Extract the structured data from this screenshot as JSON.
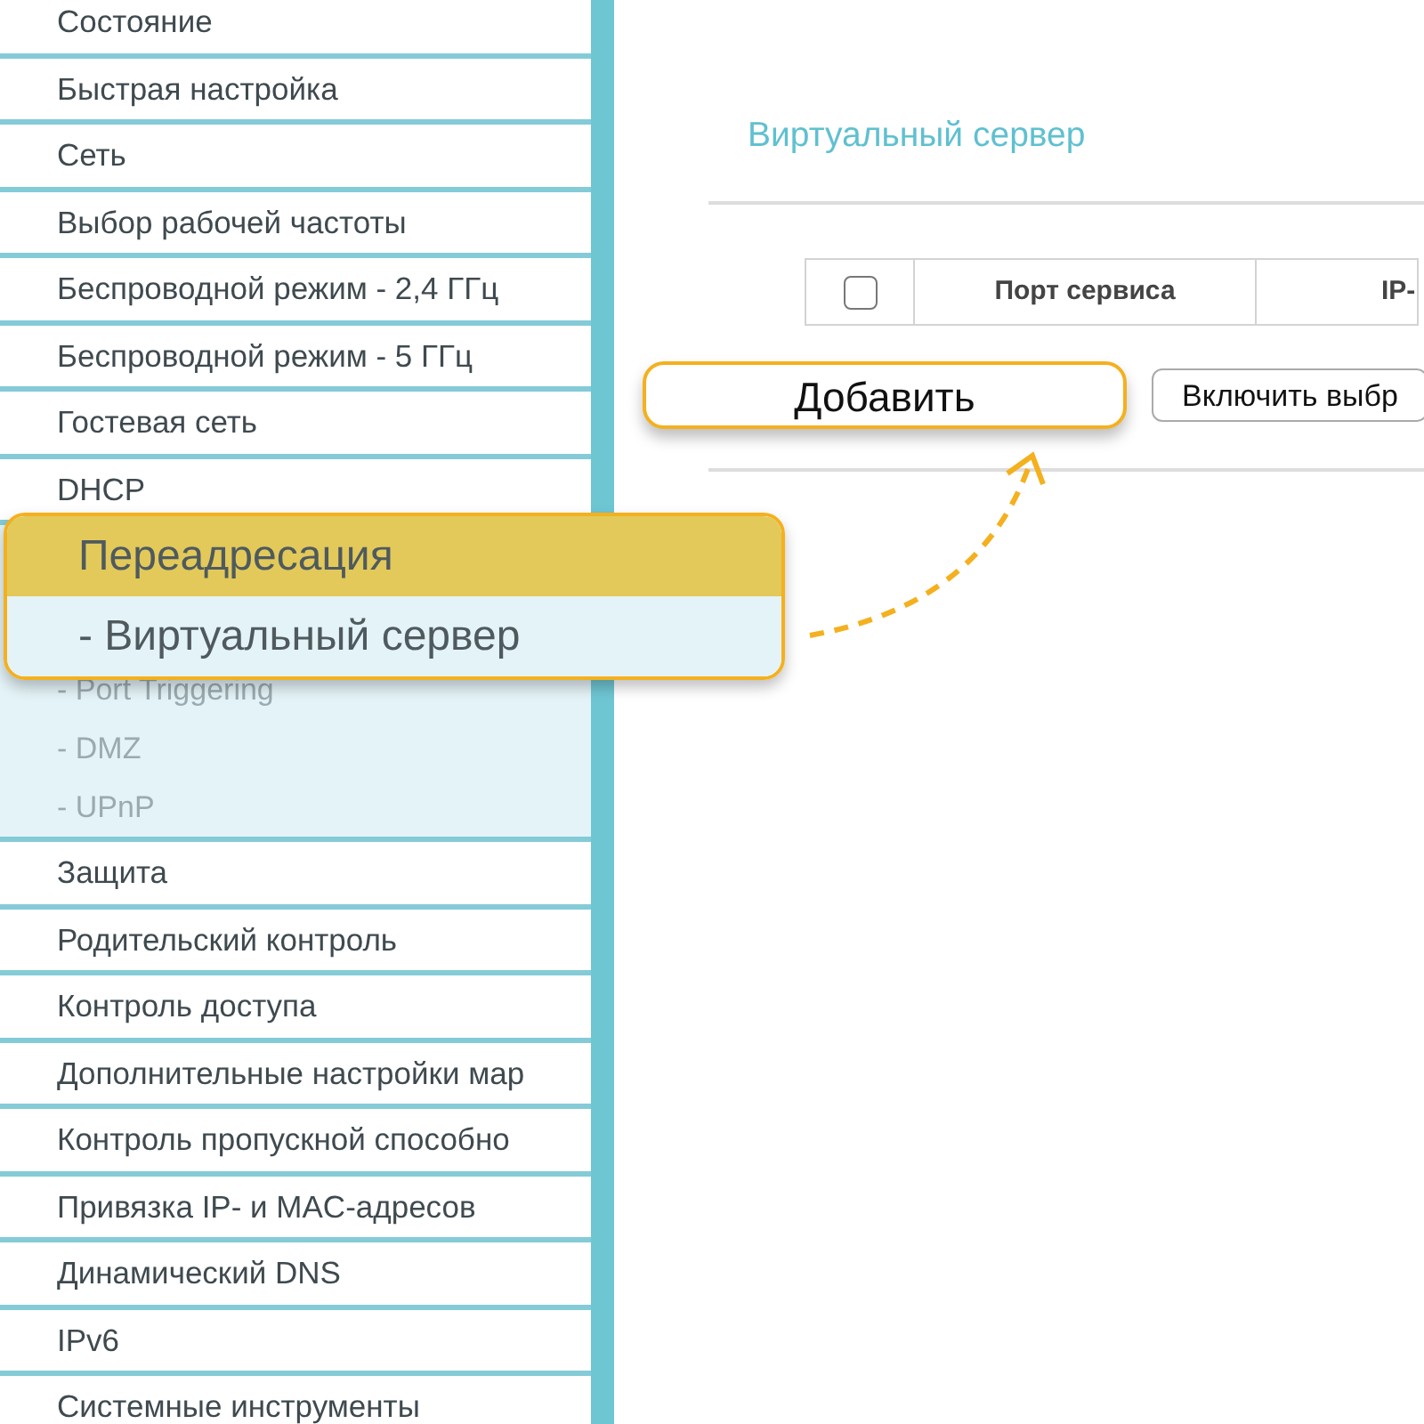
{
  "sidebar": {
    "items": [
      {
        "kind": "item",
        "label": "Состояние"
      },
      {
        "kind": "item",
        "label": "Быстрая настройка"
      },
      {
        "kind": "item",
        "label": "Сеть"
      },
      {
        "kind": "item",
        "label": "Выбор рабочей частоты"
      },
      {
        "kind": "item",
        "label": "Беспроводной режим - 2,4 ГГц"
      },
      {
        "kind": "item",
        "label": "Беспроводной режим - 5 ГГц"
      },
      {
        "kind": "item",
        "label": "Гостевая сеть"
      },
      {
        "kind": "item",
        "label": "DHCP"
      },
      {
        "kind": "group",
        "children": [
          {
            "label": "- Port Triggering"
          },
          {
            "label": "- DMZ"
          },
          {
            "label": "- UPnP"
          }
        ]
      },
      {
        "kind": "item",
        "label": "Защита"
      },
      {
        "kind": "item",
        "label": "Родительский контроль"
      },
      {
        "kind": "item",
        "label": "Контроль доступа"
      },
      {
        "kind": "item",
        "label": "Дополнительные настройки мар"
      },
      {
        "kind": "item",
        "label": "Контроль пропускной способно"
      },
      {
        "kind": "item",
        "label": "Привязка IP- и MAC-адресов"
      },
      {
        "kind": "item",
        "label": "Динамический DNS"
      },
      {
        "kind": "item",
        "label": "IPv6"
      },
      {
        "kind": "item",
        "label": "Системные инструменты"
      }
    ]
  },
  "callout": {
    "items": [
      {
        "label": "Переадресация",
        "selected": true
      },
      {
        "label": "- Виртуальный сервер",
        "selected": false
      }
    ]
  },
  "main": {
    "title": "Виртуальный сервер",
    "table": {
      "select_all_checked": false,
      "columns": [
        "Порт сервиса",
        "IP-"
      ]
    },
    "buttons": [
      {
        "label": "Добавить",
        "highlighted": true
      },
      {
        "label": "Включить выбр",
        "highlighted": false
      }
    ]
  }
}
